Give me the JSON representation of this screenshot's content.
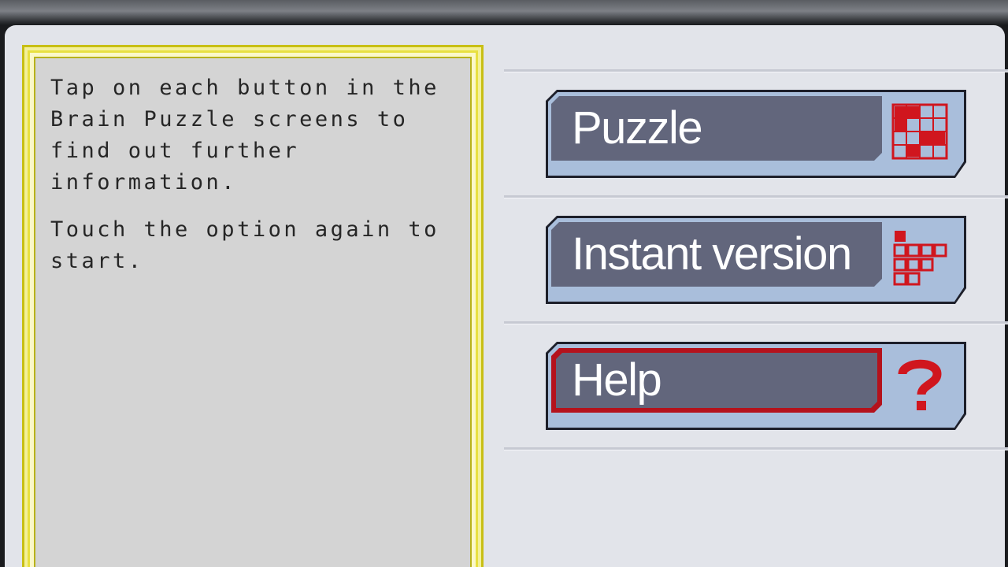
{
  "info": {
    "paragraph1": "Tap on each button in the Brain Puzzle screens to find out further information.",
    "paragraph2": "Touch the option again to start."
  },
  "menu": {
    "items": [
      {
        "label": "Puzzle",
        "icon": "puzzle-grid-icon",
        "selected": false
      },
      {
        "label": "Instant version",
        "icon": "instant-grid-icon",
        "selected": false
      },
      {
        "label": "Help",
        "icon": "question-mark-icon",
        "selected": true
      }
    ]
  },
  "colors": {
    "button_plate": "#62667c",
    "button_body": "#a9bedb",
    "selected_border": "#b4121c",
    "icon_red": "#d0161e",
    "info_border": "#e8e040"
  }
}
